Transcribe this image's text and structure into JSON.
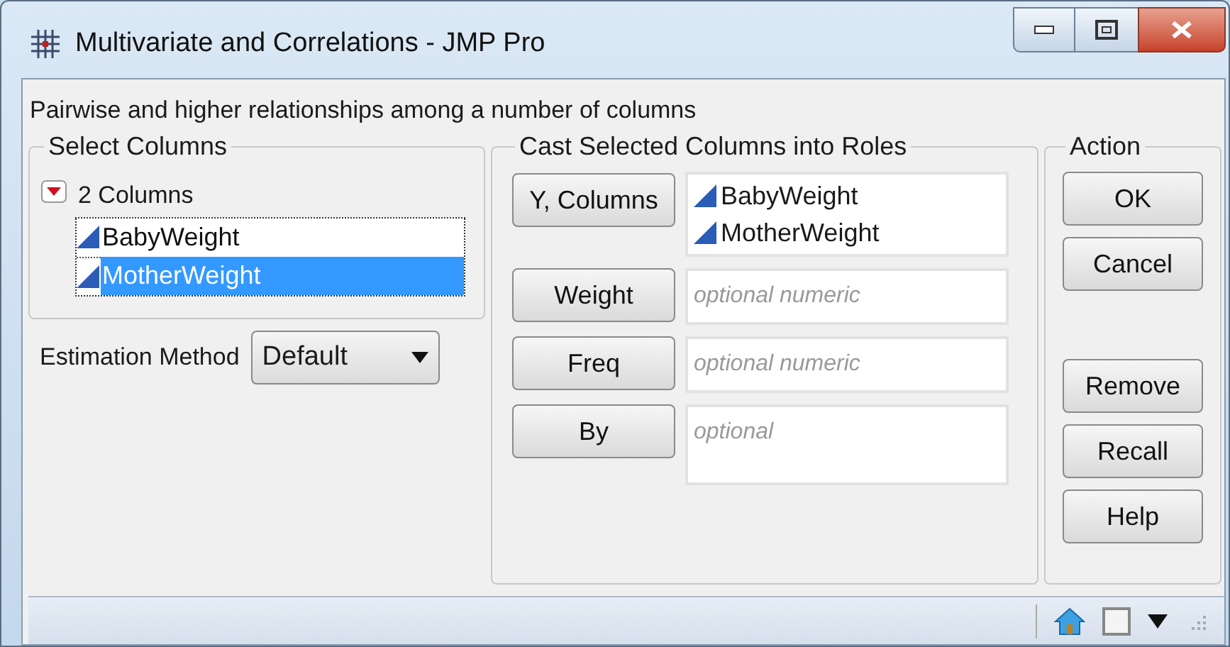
{
  "window": {
    "title": "Multivariate and Correlations - JMP Pro"
  },
  "description": "Pairwise and higher relationships among a number of columns",
  "select_columns": {
    "title": "Select Columns",
    "count_label": "2 Columns",
    "columns": [
      {
        "name": "BabyWeight",
        "selected": false
      },
      {
        "name": "MotherWeight",
        "selected": true
      }
    ]
  },
  "estimation_method": {
    "label": "Estimation Method",
    "value": "Default"
  },
  "roles": {
    "title": "Cast Selected Columns into Roles",
    "items": [
      {
        "button": "Y, Columns",
        "values": [
          "BabyWeight",
          "MotherWeight"
        ]
      },
      {
        "button": "Weight",
        "placeholder": "optional numeric"
      },
      {
        "button": "Freq",
        "placeholder": "optional numeric"
      },
      {
        "button": "By",
        "placeholder": "optional",
        "tall": true
      }
    ]
  },
  "action": {
    "title": "Action",
    "groups": [
      [
        "OK",
        "Cancel"
      ],
      [
        "Remove",
        "Recall",
        "Help"
      ]
    ]
  }
}
